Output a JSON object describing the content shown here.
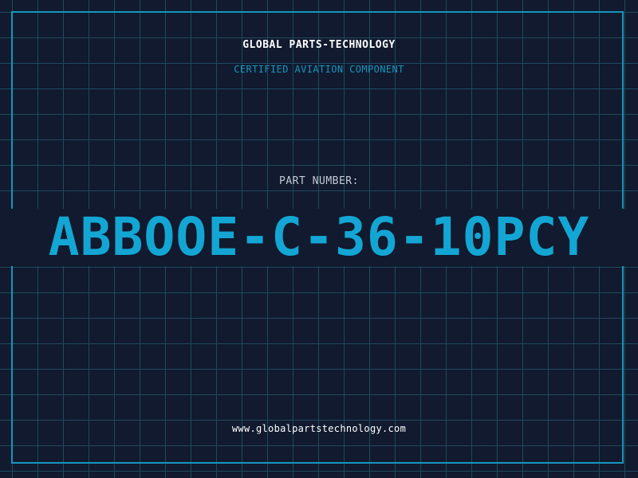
{
  "header": {
    "company": "GLOBAL PARTS-TECHNOLOGY",
    "subtitle": "CERTIFIED AVIATION COMPONENT"
  },
  "part": {
    "label": "PART NUMBER:",
    "number": "ABBOOE-C-36-10PCY"
  },
  "footer": {
    "website": "www.globalpartstechnology.com"
  },
  "colors": {
    "background": "#111a2e",
    "grid": "#1f4a5e",
    "accent": "#13a6d4",
    "text": "#ffffff",
    "label": "#c4cad4"
  }
}
